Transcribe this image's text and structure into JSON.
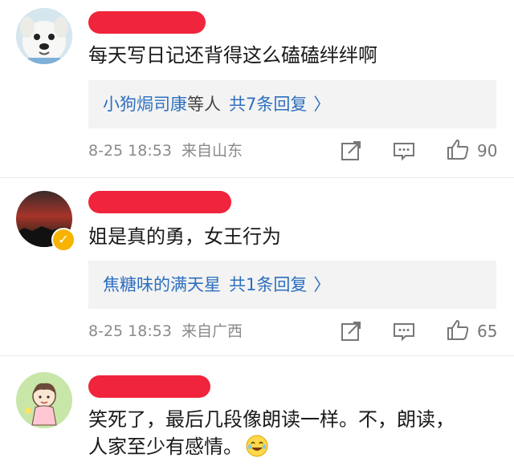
{
  "comments": [
    {
      "text": "每天写日记还背得这么磕磕绊绊啊",
      "reply_names": "小狗焗司康",
      "reply_suffix": "等人",
      "reply_count": "共7条回复",
      "time": "8-25 18:53",
      "location": "来自山东",
      "likes": "90"
    },
    {
      "text": "姐是真的勇，女王行为",
      "reply_names": "焦糖味的满天星",
      "reply_suffix": "",
      "reply_count": "共1条回复",
      "time": "8-25 18:53",
      "location": "来自广西",
      "likes": "65"
    },
    {
      "text_line1": "笑死了，最后几段像朗读一样。不，朗读，",
      "text_line2": "人家至少有感情。"
    }
  ],
  "icons": [
    "share-icon",
    "comment-icon",
    "like-icon",
    "chevron-right-icon",
    "verified-badge-icon",
    "laugh-emoji-icon"
  ],
  "colors": {
    "redaction": "#f0243c",
    "link": "#2d6fbf",
    "reply_bg": "#f3f3f3",
    "meta": "#8a8a8a",
    "badge": "#f6b400"
  }
}
